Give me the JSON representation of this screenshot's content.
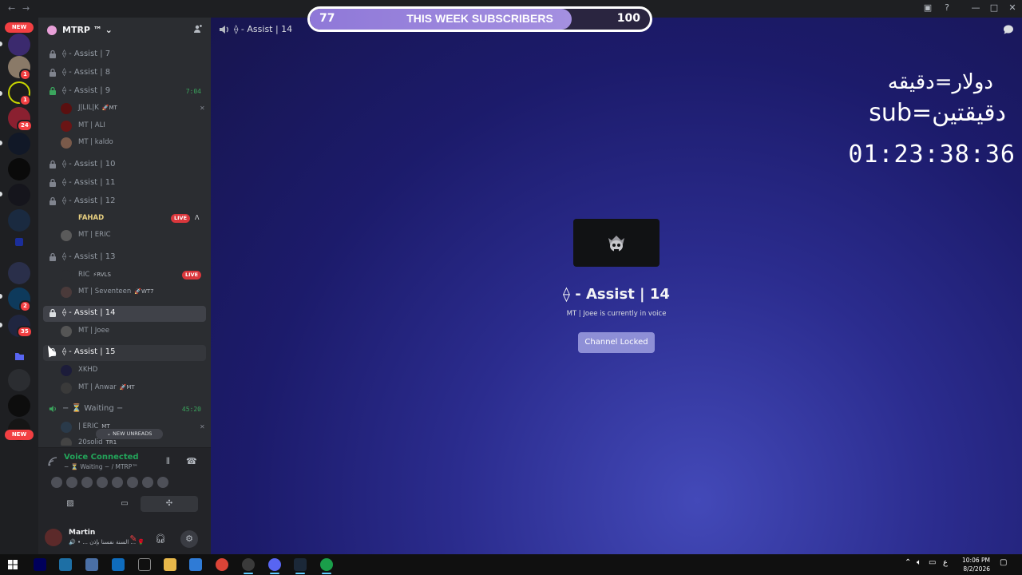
{
  "window": {
    "back": "←",
    "forward": "→"
  },
  "server_rail": {
    "new_top": "NEW",
    "new_bottom": "NEW",
    "badges": [
      "1",
      "1",
      "24",
      "2",
      "35"
    ]
  },
  "guild": {
    "name": "MTRP ™ ⌄"
  },
  "channels": [
    {
      "name": "⟠ - Assist | 7"
    },
    {
      "name": "⟠ - Assist | 8"
    },
    {
      "name": "⟠ - Assist | 9",
      "time": "7:04"
    },
    {
      "name": "⟠ - Assist | 10"
    },
    {
      "name": "⟠ - Assist | 11"
    },
    {
      "name": "⟠ - Assist | 12"
    },
    {
      "name": "⟠ - Assist | 13"
    },
    {
      "name": "⟠ - Assist | 14"
    },
    {
      "name": "⟠ - Assist | 15"
    },
    {
      "name": "− ⏳ Waiting −",
      "time": "45:20"
    }
  ],
  "users": {
    "assist9": [
      {
        "name": "J|LIL|K",
        "tag": "🚀MT"
      },
      {
        "name": "MT | ALI"
      },
      {
        "name": "MT | kaldo"
      }
    ],
    "assist12": [
      {
        "name": "FAHAD",
        "live": "LIVE"
      },
      {
        "name": "MT | ERIC"
      }
    ],
    "assist13": [
      {
        "name": "RIC",
        "tag": "⚡RVLS",
        "live": "LIVE"
      },
      {
        "name": "MT | Seventeen",
        "tag": "🚀WT7"
      }
    ],
    "assist14": [
      {
        "name": "MT | Joee"
      }
    ],
    "assist15": [
      {
        "name": "XKHD"
      },
      {
        "name": "MT | Anwar",
        "tag": "🚀MT"
      }
    ],
    "waiting": [
      {
        "name": "| ERIC",
        "tag": "MT"
      },
      {
        "name": "20solid",
        "tag": "TR1"
      }
    ]
  },
  "new_unreads": "⌄ NEW UNREADS",
  "voice": {
    "title": "Voice Connected",
    "subtitle": "− ⏳ Waiting − / MTRP™"
  },
  "me": {
    "name": "Martin",
    "status": "🔊 • ... السنة نفسنا بإذن ... 🌹"
  },
  "stage": {
    "header_title": "⟠ - Assist | 14",
    "channel_title": "⟠ - Assist | 14",
    "channel_sub": "MT | Joee is currently in voice",
    "locked_button": "Channel Locked"
  },
  "overlay": {
    "left_value": "77",
    "label": "THIS WEEK SUBSCRIBERS",
    "right_value": "100",
    "progress": 0.77
  },
  "stream_text": {
    "line1": "دولار=دقيقه",
    "line2": "sub=دقيقتين",
    "timer": "01:23:38:36"
  },
  "taskbar": {
    "time": "10:06 PM",
    "date": "8/2/2026",
    "lang": "ع"
  },
  "colors": {
    "accent_green": "#23a55a",
    "live_red": "#da373c",
    "button_blurple": "#8e8fd6",
    "sidebar_bg": "#2b2d31"
  }
}
